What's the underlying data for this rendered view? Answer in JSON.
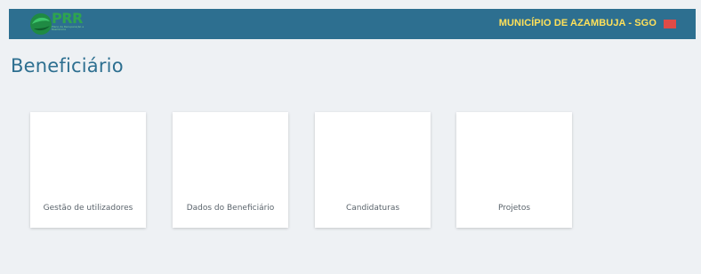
{
  "header": {
    "logo_text": "PRR",
    "logo_subtitle": "Plano de Recuperação e Resiliência",
    "entity_label": "MUNICÍPIO DE AZAMBUJA - SGO",
    "flag_color": "#e04b47",
    "bar_color": "#2d6f90"
  },
  "page": {
    "title": "Beneficiário"
  },
  "cards": [
    {
      "label": "Gestão de utilizadores"
    },
    {
      "label": "Dados do Beneficiário"
    },
    {
      "label": "Candidaturas"
    },
    {
      "label": "Projetos"
    }
  ]
}
